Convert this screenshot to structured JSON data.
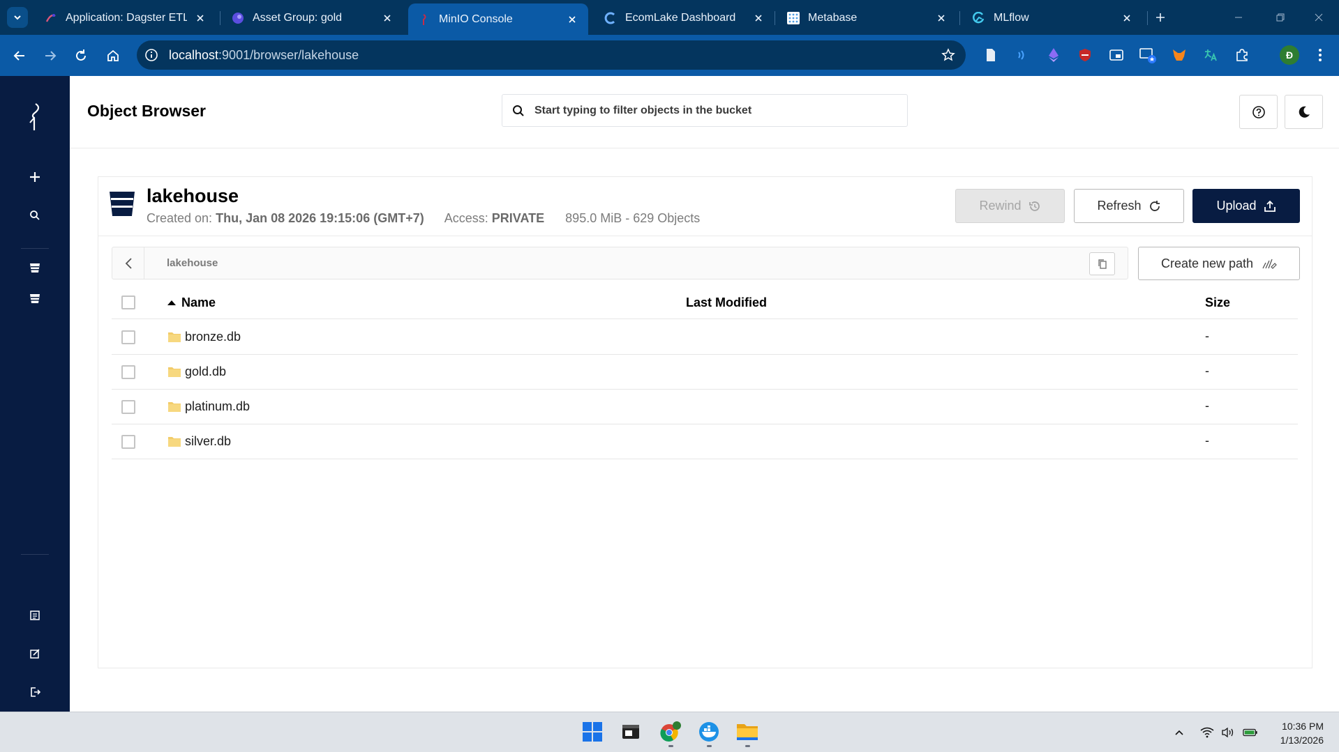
{
  "browser": {
    "tabs": [
      {
        "title": "Application: Dagster ETL Pi",
        "active": false
      },
      {
        "title": "Asset Group: gold",
        "active": false
      },
      {
        "title": "MinIO Console",
        "active": true
      },
      {
        "title": "EcomLake Dashboard",
        "active": false
      },
      {
        "title": "Metabase",
        "active": false
      },
      {
        "title": "MLflow",
        "active": false
      }
    ],
    "url_host": "localhost",
    "url_path": ":9001/browser/lakehouse",
    "profile_initial": "Đ"
  },
  "header": {
    "title": "Object Browser",
    "search_placeholder": "Start typing to filter objects in the bucket"
  },
  "bucket": {
    "name": "lakehouse",
    "created_label": "Created on:",
    "created_value": "Thu, Jan 08 2026 19:15:06 (GMT+7)",
    "access_label": "Access:",
    "access_value": "PRIVATE",
    "size_objects": "895.0 MiB - 629 Objects"
  },
  "actions": {
    "rewind": "Rewind",
    "refresh": "Refresh",
    "upload": "Upload",
    "create_path": "Create new path"
  },
  "breadcrumb": {
    "path": "lakehouse"
  },
  "table": {
    "columns": {
      "name": "Name",
      "modified": "Last Modified",
      "size": "Size"
    },
    "rows": [
      {
        "name": "bronze.db",
        "modified": "",
        "size": "-"
      },
      {
        "name": "gold.db",
        "modified": "",
        "size": "-"
      },
      {
        "name": "platinum.db",
        "modified": "",
        "size": "-"
      },
      {
        "name": "silver.db",
        "modified": "",
        "size": "-"
      }
    ]
  },
  "taskbar": {
    "time": "10:36 PM",
    "date": "1/13/2026"
  },
  "colors": {
    "sidebar": "#081c42",
    "upload_button": "#081c42",
    "browser_toolbar": "#0b5aa6",
    "browser_tabbar": "#04355e",
    "folder": "#f2cc6a"
  }
}
